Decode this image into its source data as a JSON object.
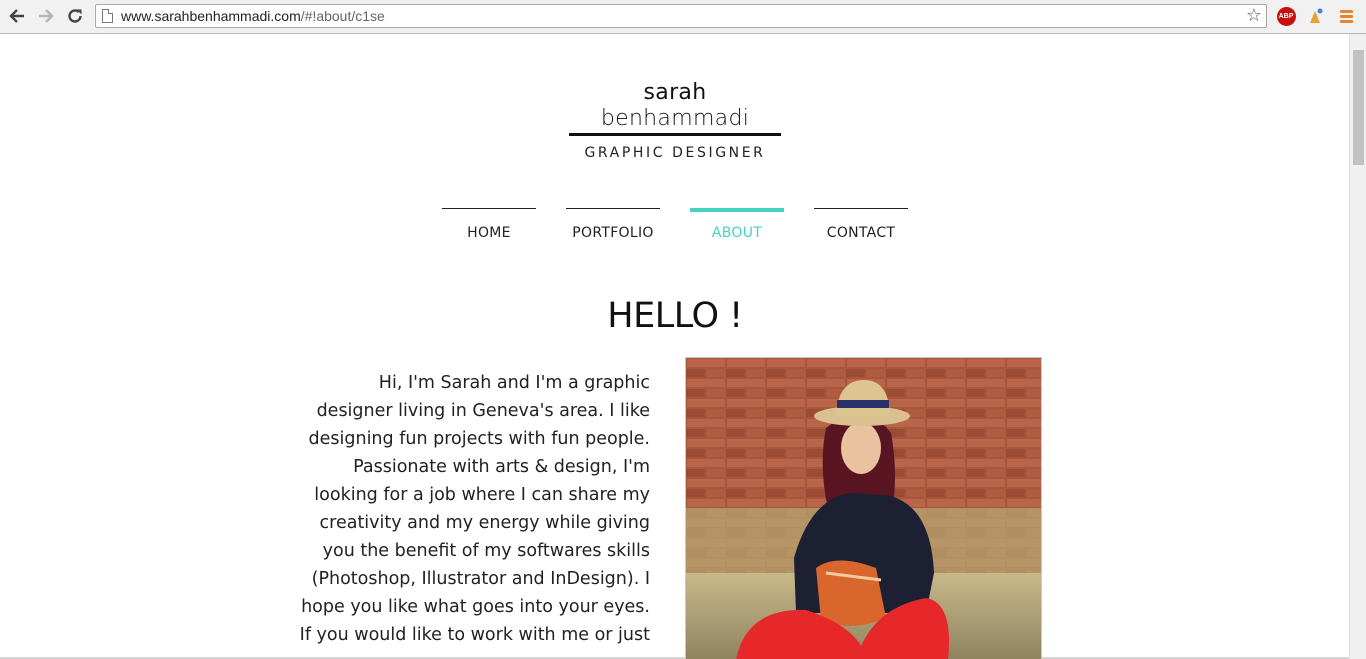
{
  "browser": {
    "url_domain": "www.sarahbenhammadi.com",
    "url_path": "/#!about/c1se",
    "extensions": [
      "adblock-plus-icon",
      "extension-icon"
    ],
    "abp_label": "ABP"
  },
  "site": {
    "name_first": "sarah",
    "name_last": "benhammadi",
    "tagline": "GRAPHIC DESIGNER"
  },
  "nav": {
    "items": [
      {
        "label": "HOME"
      },
      {
        "label": "PORTFOLIO"
      },
      {
        "label": "ABOUT",
        "active": true
      },
      {
        "label": "CONTACT"
      }
    ],
    "accent_color": "#46d2c0"
  },
  "about": {
    "heading": "HELLO !",
    "lines": [
      "Hi, I'm Sarah and I'm a graphic",
      "designer living in Geneva's area. I like",
      "designing fun projects with fun people.",
      "Passionate with arts & design, I'm",
      "looking for a job where I can share my",
      "creativity and my energy while giving",
      "you the benefit of my softwares skills",
      "(Photoshop, Illustrator and InDesign). I",
      "hope you like what goes into your eyes.",
      "If you would like to work with me or just"
    ]
  }
}
